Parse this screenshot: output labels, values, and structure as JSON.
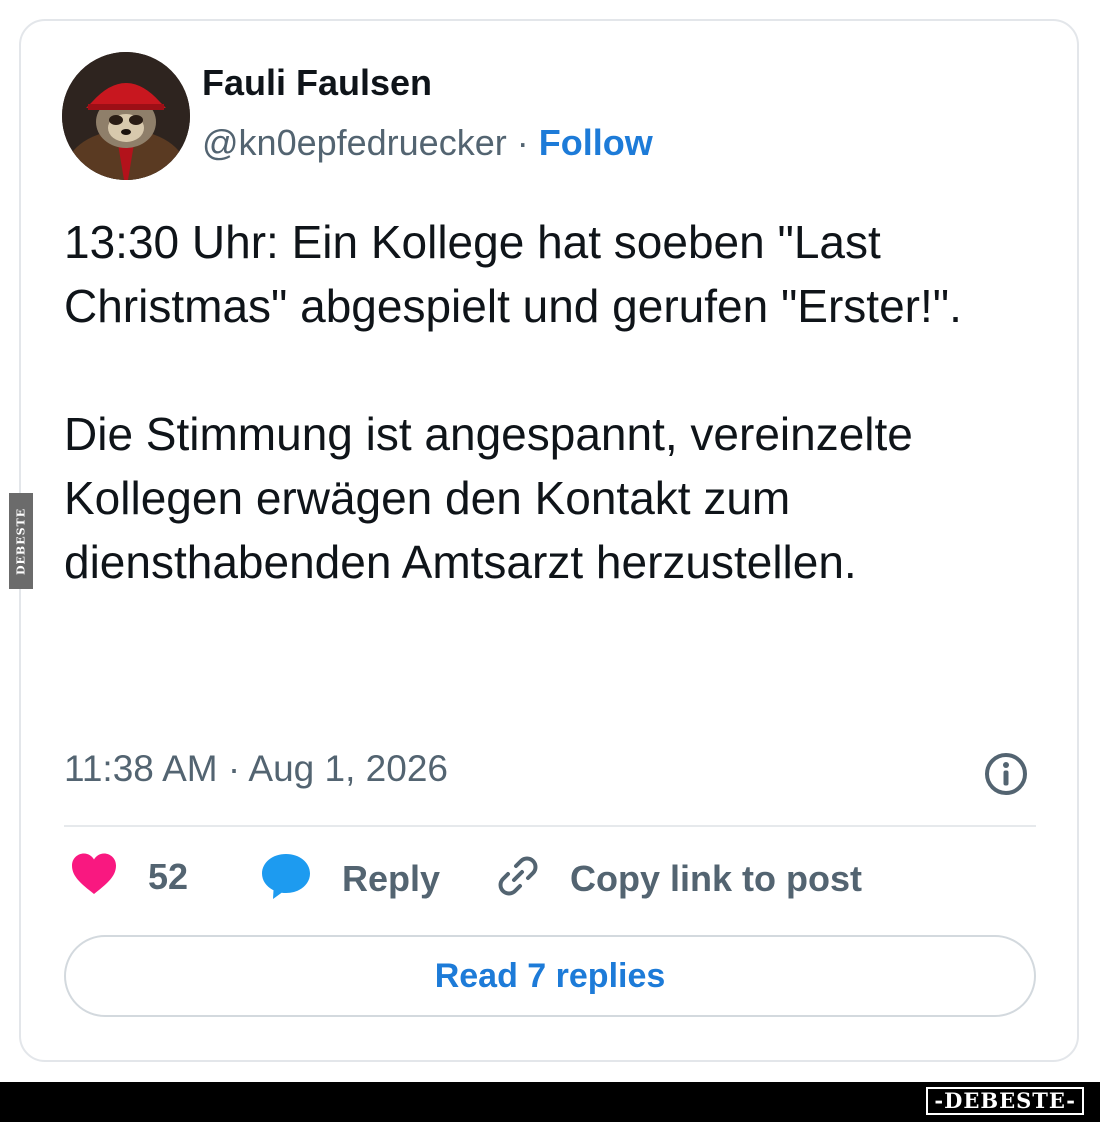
{
  "post": {
    "author": {
      "display_name": "Fauli Faulsen",
      "handle": "@kn0epfedruecker",
      "separator": " · ",
      "follow_label": "Follow"
    },
    "text": "13:30 Uhr: Ein Kollege hat soeben \"Last Christmas\" abgespielt und gerufen \"Erster!\".\n\nDie Stimmung ist angespannt, vereinzelte Kollegen erwägen den Kontakt zum diensthabenden Amtsarzt herzustellen.",
    "timestamp": "11:38 AM · Aug 1, 2026",
    "actions": {
      "like_count": "52",
      "reply_label": "Reply",
      "copy_link_label": "Copy link to post"
    },
    "read_replies_label": "Read 7 replies"
  },
  "icons": {
    "info": "info-icon",
    "like": "heart-icon",
    "reply": "speech-bubble-icon",
    "copy_link": "link-icon"
  },
  "colors": {
    "accent": "#1d7bd8",
    "heart": "#f91880",
    "muted_text": "#536471",
    "text": "#0f1419"
  },
  "watermarks": {
    "side": "DEBESTE",
    "bottom": "-DEBESTE-"
  }
}
